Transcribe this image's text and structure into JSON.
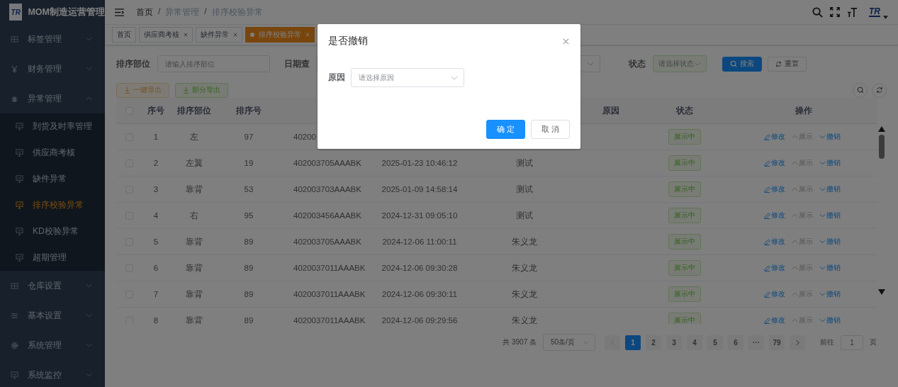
{
  "sidebar": {
    "logo": "TR",
    "title": "MOM制造运营管理",
    "items": [
      {
        "label": "标签管理",
        "expanded": false
      },
      {
        "label": "财务管理",
        "expanded": false
      },
      {
        "label": "异常管理",
        "expanded": true,
        "children": [
          {
            "label": "到货及时率管理",
            "selected": false
          },
          {
            "label": "供应商考核",
            "selected": false
          },
          {
            "label": "缺件异常",
            "selected": false
          },
          {
            "label": "排序校验异常",
            "selected": true
          },
          {
            "label": "KD校验异常",
            "selected": false
          },
          {
            "label": "超期管理",
            "selected": false
          }
        ]
      },
      {
        "label": "仓库设置",
        "expanded": false
      },
      {
        "label": "基本设置",
        "expanded": false
      },
      {
        "label": "系统管理",
        "expanded": false
      },
      {
        "label": "系统监控",
        "expanded": false
      }
    ]
  },
  "header": {
    "breadcrumb": [
      "首页",
      "异常管理",
      "排序校验异常"
    ],
    "separator": "/",
    "avatar_logo": "TR"
  },
  "tags": [
    {
      "label": "首页",
      "closable": false,
      "selected": false
    },
    {
      "label": "供应商考核",
      "closable": true,
      "selected": false
    },
    {
      "label": "缺件异常",
      "closable": true,
      "selected": false
    },
    {
      "label": "排序校验异常",
      "closable": true,
      "selected": true
    }
  ],
  "filters": {
    "part_label": "排序部位",
    "part_placeholder": "请输入排序部位",
    "date_label": "日期查",
    "status_label": "状态",
    "status_placeholder": "请选择状态",
    "search": "搜索",
    "reset": "重置"
  },
  "toolbar": {
    "export_all": "一键导出",
    "export_some": "部分导出"
  },
  "table": {
    "all_checked": false,
    "columns": [
      "序号",
      "排序部位",
      "排序号",
      "",
      "",
      "",
      "原因",
      "状态",
      "操作"
    ],
    "rows": [
      {
        "checked": false,
        "no": "1",
        "position": "左",
        "seq": "97",
        "part": "40200",
        "date": "",
        "creator": "",
        "status": "展示中",
        "actions": [
          {
            "label": "修改",
            "kind": "edit",
            "disabled": false
          },
          {
            "label": "展示",
            "kind": "show",
            "disabled": true
          },
          {
            "label": "撤销",
            "kind": "revoke",
            "disabled": false
          }
        ]
      },
      {
        "checked": false,
        "no": "2",
        "position": "左翼",
        "seq": "19",
        "part": "402003705AAABK",
        "date": "2025-01-23 10:46:12",
        "creator": "测试",
        "status": "展示中",
        "actions": [
          {
            "label": "修改",
            "kind": "edit",
            "disabled": false
          },
          {
            "label": "展示",
            "kind": "show",
            "disabled": true
          },
          {
            "label": "撤销",
            "kind": "revoke",
            "disabled": false
          }
        ]
      },
      {
        "checked": false,
        "no": "3",
        "position": "靠背",
        "seq": "53",
        "part": "402003703AAABK",
        "date": "2025-01-09 14:58:14",
        "creator": "测试",
        "status": "展示中",
        "actions": [
          {
            "label": "修改",
            "kind": "edit",
            "disabled": false
          },
          {
            "label": "展示",
            "kind": "show",
            "disabled": true
          },
          {
            "label": "撤销",
            "kind": "revoke",
            "disabled": false
          }
        ]
      },
      {
        "checked": false,
        "no": "4",
        "position": "右",
        "seq": "95",
        "part": "402003456AAABK",
        "date": "2024-12-31 09:05:10",
        "creator": "测试",
        "status": "展示中",
        "actions": [
          {
            "label": "修改",
            "kind": "edit",
            "disabled": false
          },
          {
            "label": "展示",
            "kind": "show",
            "disabled": true
          },
          {
            "label": "撤销",
            "kind": "revoke",
            "disabled": false
          }
        ]
      },
      {
        "checked": false,
        "no": "5",
        "position": "靠背",
        "seq": "89",
        "part": "402003705AAABK",
        "date": "2024-12-06 11:00:11",
        "creator": "朱义龙",
        "status": "展示中",
        "actions": [
          {
            "label": "修改",
            "kind": "edit",
            "disabled": false
          },
          {
            "label": "展示",
            "kind": "show",
            "disabled": true
          },
          {
            "label": "撤销",
            "kind": "revoke",
            "disabled": false
          }
        ]
      },
      {
        "checked": false,
        "no": "6",
        "position": "靠背",
        "seq": "89",
        "part": "4020037011AAABK",
        "date": "2024-12-06 09:30:28",
        "creator": "朱义龙",
        "status": "展示中",
        "actions": [
          {
            "label": "修改",
            "kind": "edit",
            "disabled": false
          },
          {
            "label": "展示",
            "kind": "show",
            "disabled": true
          },
          {
            "label": "撤销",
            "kind": "revoke",
            "disabled": false
          }
        ]
      },
      {
        "checked": false,
        "no": "7",
        "position": "靠背",
        "seq": "89",
        "part": "4020037011AAABK",
        "date": "2024-12-06 09:30:11",
        "creator": "朱义龙",
        "status": "展示中",
        "actions": [
          {
            "label": "修改",
            "kind": "edit",
            "disabled": false
          },
          {
            "label": "展示",
            "kind": "show",
            "disabled": true
          },
          {
            "label": "撤销",
            "kind": "revoke",
            "disabled": false
          }
        ]
      },
      {
        "checked": false,
        "no": "8",
        "position": "靠背",
        "seq": "89",
        "part": "4020037011AAABK",
        "date": "2024-12-06 09:29:56",
        "creator": "朱义龙",
        "status": "展示中",
        "actions": [
          {
            "label": "修改",
            "kind": "edit",
            "disabled": false
          },
          {
            "label": "展示",
            "kind": "show",
            "disabled": true
          },
          {
            "label": "撤销",
            "kind": "revoke",
            "disabled": false
          }
        ]
      }
    ]
  },
  "pagination": {
    "total": "共 3907 条",
    "page_size": "50条/页",
    "pages": [
      {
        "label": "1",
        "selected": true
      },
      {
        "label": "2",
        "selected": false
      },
      {
        "label": "3",
        "selected": false
      },
      {
        "label": "4",
        "selected": false
      },
      {
        "label": "5",
        "selected": false
      },
      {
        "label": "6",
        "selected": false
      },
      {
        "label": "···",
        "selected": false
      },
      {
        "label": "79",
        "selected": false
      }
    ],
    "goto": "前往",
    "goto_value": "1",
    "page_unit": "页"
  },
  "dialog": {
    "title": "是否撤销",
    "field_label": "原因",
    "field_placeholder": "请选择原因",
    "confirm": "确 定",
    "cancel": "取 消"
  }
}
